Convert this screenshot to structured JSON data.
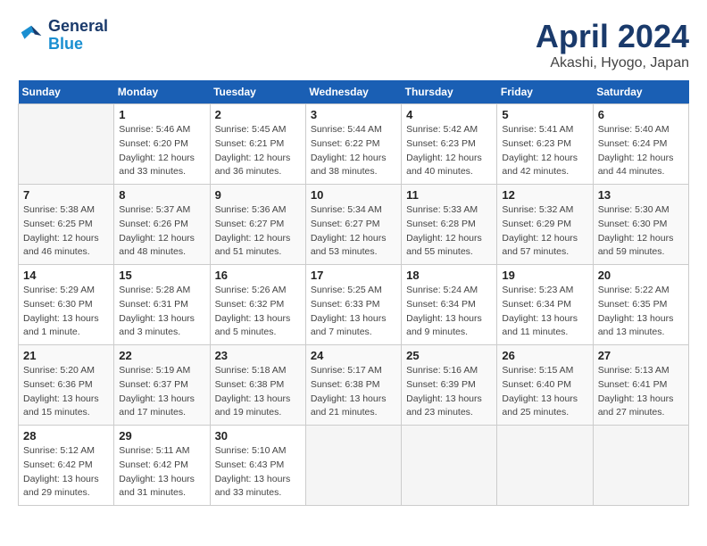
{
  "header": {
    "logo_line1": "General",
    "logo_line2": "Blue",
    "title": "April 2024",
    "subtitle": "Akashi, Hyogo, Japan"
  },
  "weekdays": [
    "Sunday",
    "Monday",
    "Tuesday",
    "Wednesday",
    "Thursday",
    "Friday",
    "Saturday"
  ],
  "weeks": [
    [
      {
        "day": "",
        "info": ""
      },
      {
        "day": "1",
        "info": "Sunrise: 5:46 AM\nSunset: 6:20 PM\nDaylight: 12 hours\nand 33 minutes."
      },
      {
        "day": "2",
        "info": "Sunrise: 5:45 AM\nSunset: 6:21 PM\nDaylight: 12 hours\nand 36 minutes."
      },
      {
        "day": "3",
        "info": "Sunrise: 5:44 AM\nSunset: 6:22 PM\nDaylight: 12 hours\nand 38 minutes."
      },
      {
        "day": "4",
        "info": "Sunrise: 5:42 AM\nSunset: 6:23 PM\nDaylight: 12 hours\nand 40 minutes."
      },
      {
        "day": "5",
        "info": "Sunrise: 5:41 AM\nSunset: 6:23 PM\nDaylight: 12 hours\nand 42 minutes."
      },
      {
        "day": "6",
        "info": "Sunrise: 5:40 AM\nSunset: 6:24 PM\nDaylight: 12 hours\nand 44 minutes."
      }
    ],
    [
      {
        "day": "7",
        "info": "Sunrise: 5:38 AM\nSunset: 6:25 PM\nDaylight: 12 hours\nand 46 minutes."
      },
      {
        "day": "8",
        "info": "Sunrise: 5:37 AM\nSunset: 6:26 PM\nDaylight: 12 hours\nand 48 minutes."
      },
      {
        "day": "9",
        "info": "Sunrise: 5:36 AM\nSunset: 6:27 PM\nDaylight: 12 hours\nand 51 minutes."
      },
      {
        "day": "10",
        "info": "Sunrise: 5:34 AM\nSunset: 6:27 PM\nDaylight: 12 hours\nand 53 minutes."
      },
      {
        "day": "11",
        "info": "Sunrise: 5:33 AM\nSunset: 6:28 PM\nDaylight: 12 hours\nand 55 minutes."
      },
      {
        "day": "12",
        "info": "Sunrise: 5:32 AM\nSunset: 6:29 PM\nDaylight: 12 hours\nand 57 minutes."
      },
      {
        "day": "13",
        "info": "Sunrise: 5:30 AM\nSunset: 6:30 PM\nDaylight: 12 hours\nand 59 minutes."
      }
    ],
    [
      {
        "day": "14",
        "info": "Sunrise: 5:29 AM\nSunset: 6:30 PM\nDaylight: 13 hours\nand 1 minute."
      },
      {
        "day": "15",
        "info": "Sunrise: 5:28 AM\nSunset: 6:31 PM\nDaylight: 13 hours\nand 3 minutes."
      },
      {
        "day": "16",
        "info": "Sunrise: 5:26 AM\nSunset: 6:32 PM\nDaylight: 13 hours\nand 5 minutes."
      },
      {
        "day": "17",
        "info": "Sunrise: 5:25 AM\nSunset: 6:33 PM\nDaylight: 13 hours\nand 7 minutes."
      },
      {
        "day": "18",
        "info": "Sunrise: 5:24 AM\nSunset: 6:34 PM\nDaylight: 13 hours\nand 9 minutes."
      },
      {
        "day": "19",
        "info": "Sunrise: 5:23 AM\nSunset: 6:34 PM\nDaylight: 13 hours\nand 11 minutes."
      },
      {
        "day": "20",
        "info": "Sunrise: 5:22 AM\nSunset: 6:35 PM\nDaylight: 13 hours\nand 13 minutes."
      }
    ],
    [
      {
        "day": "21",
        "info": "Sunrise: 5:20 AM\nSunset: 6:36 PM\nDaylight: 13 hours\nand 15 minutes."
      },
      {
        "day": "22",
        "info": "Sunrise: 5:19 AM\nSunset: 6:37 PM\nDaylight: 13 hours\nand 17 minutes."
      },
      {
        "day": "23",
        "info": "Sunrise: 5:18 AM\nSunset: 6:38 PM\nDaylight: 13 hours\nand 19 minutes."
      },
      {
        "day": "24",
        "info": "Sunrise: 5:17 AM\nSunset: 6:38 PM\nDaylight: 13 hours\nand 21 minutes."
      },
      {
        "day": "25",
        "info": "Sunrise: 5:16 AM\nSunset: 6:39 PM\nDaylight: 13 hours\nand 23 minutes."
      },
      {
        "day": "26",
        "info": "Sunrise: 5:15 AM\nSunset: 6:40 PM\nDaylight: 13 hours\nand 25 minutes."
      },
      {
        "day": "27",
        "info": "Sunrise: 5:13 AM\nSunset: 6:41 PM\nDaylight: 13 hours\nand 27 minutes."
      }
    ],
    [
      {
        "day": "28",
        "info": "Sunrise: 5:12 AM\nSunset: 6:42 PM\nDaylight: 13 hours\nand 29 minutes."
      },
      {
        "day": "29",
        "info": "Sunrise: 5:11 AM\nSunset: 6:42 PM\nDaylight: 13 hours\nand 31 minutes."
      },
      {
        "day": "30",
        "info": "Sunrise: 5:10 AM\nSunset: 6:43 PM\nDaylight: 13 hours\nand 33 minutes."
      },
      {
        "day": "",
        "info": ""
      },
      {
        "day": "",
        "info": ""
      },
      {
        "day": "",
        "info": ""
      },
      {
        "day": "",
        "info": ""
      }
    ]
  ]
}
